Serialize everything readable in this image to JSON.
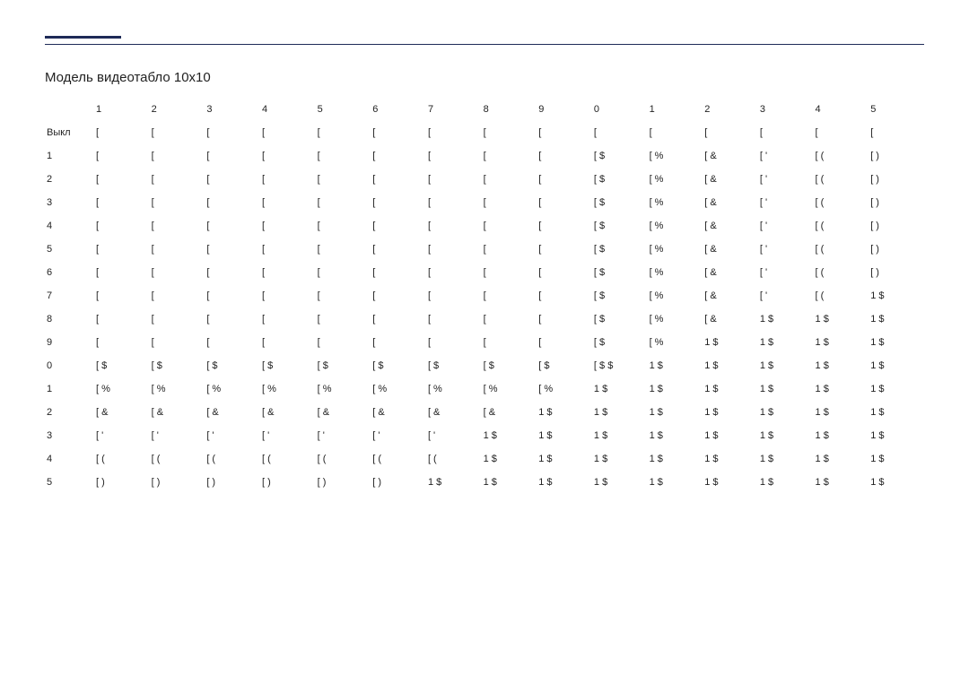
{
  "title": "Модель видеотабло 10x10",
  "col_headers": [
    "1",
    "2",
    "3",
    "4",
    "5",
    "6",
    "7",
    "8",
    "9",
    "0",
    "1",
    "2",
    "3",
    "4",
    "5"
  ],
  "row_headers": [
    "Выкл",
    "1",
    "2",
    "3",
    "4",
    "5",
    "6",
    "7",
    "8",
    "9",
    "0",
    "1",
    "2",
    "3",
    "4",
    "5"
  ],
  "rows": [
    [
      "[",
      "[",
      "[",
      "[",
      "[",
      "[",
      "[",
      "[",
      "[",
      "[",
      "[",
      "[",
      "[",
      "[",
      "["
    ],
    [
      "[",
      "[",
      "[",
      "[",
      "[",
      "[",
      "[",
      "[",
      "[",
      "[ $",
      "[ %",
      "[ &",
      "[ '",
      "[ (",
      "[ )"
    ],
    [
      "[",
      "[",
      "[",
      "[",
      "[",
      "[",
      "[",
      "[",
      "[",
      "[ $",
      "[ %",
      "[ &",
      "[ '",
      "[ (",
      "[ )"
    ],
    [
      "[",
      "[",
      "[",
      "[",
      "[",
      "[",
      "[",
      "[",
      "[",
      "[ $",
      "[ %",
      "[ &",
      "[ '",
      "[ (",
      "[ )"
    ],
    [
      "[",
      "[",
      "[",
      "[",
      "[",
      "[",
      "[",
      "[",
      "[",
      "[ $",
      "[ %",
      "[ &",
      "[ '",
      "[ (",
      "[ )"
    ],
    [
      "[",
      "[",
      "[",
      "[",
      "[",
      "[",
      "[",
      "[",
      "[",
      "[ $",
      "[ %",
      "[ &",
      "[ '",
      "[ (",
      "[ )"
    ],
    [
      "[",
      "[",
      "[",
      "[",
      "[",
      "[",
      "[",
      "[",
      "[",
      "[ $",
      "[ %",
      "[ &",
      "[ '",
      "[ (",
      "[ )"
    ],
    [
      "[",
      "[",
      "[",
      "[",
      "[",
      "[",
      "[",
      "[",
      "[",
      "[ $",
      "[ %",
      "[ &",
      "[ '",
      "[ (",
      "1 $"
    ],
    [
      "[",
      "[",
      "[",
      "[",
      "[",
      "[",
      "[",
      "[",
      "[",
      "[ $",
      "[ %",
      "[ &",
      "1 $",
      "1 $",
      "1 $"
    ],
    [
      "[",
      "[",
      "[",
      "[",
      "[",
      "[",
      "[",
      "[",
      "[",
      "[ $",
      "[ %",
      "1 $",
      "1 $",
      "1 $",
      "1 $"
    ],
    [
      "[ $",
      "[ $",
      "[ $",
      "[ $",
      "[ $",
      "[ $",
      "[ $",
      "[ $",
      "[ $",
      "[ $ $",
      "1 $",
      "1 $",
      "1 $",
      "1 $",
      "1 $"
    ],
    [
      "[ %",
      "[ %",
      "[ %",
      "[ %",
      "[ %",
      "[ %",
      "[ %",
      "[ %",
      "[ %",
      "1 $",
      "1 $",
      "1 $",
      "1 $",
      "1 $",
      "1 $"
    ],
    [
      "[ &",
      "[ &",
      "[ &",
      "[ &",
      "[ &",
      "[ &",
      "[ &",
      "[ &",
      "1 $",
      "1 $",
      "1 $",
      "1 $",
      "1 $",
      "1 $",
      "1 $"
    ],
    [
      "[ '",
      "[ '",
      "[ '",
      "[ '",
      "[ '",
      "[ '",
      "[ '",
      "1 $",
      "1 $",
      "1 $",
      "1 $",
      "1 $",
      "1 $",
      "1 $",
      "1 $"
    ],
    [
      "[ (",
      "[ (",
      "[ (",
      "[ (",
      "[ (",
      "[ (",
      "[ (",
      "1 $",
      "1 $",
      "1 $",
      "1 $",
      "1 $",
      "1 $",
      "1 $",
      "1 $"
    ],
    [
      "[ )",
      "[ )",
      "[ )",
      "[ )",
      "[ )",
      "[ )",
      "1 $",
      "1 $",
      "1 $",
      "1 $",
      "1 $",
      "1 $",
      "1 $",
      "1 $",
      "1 $"
    ]
  ]
}
